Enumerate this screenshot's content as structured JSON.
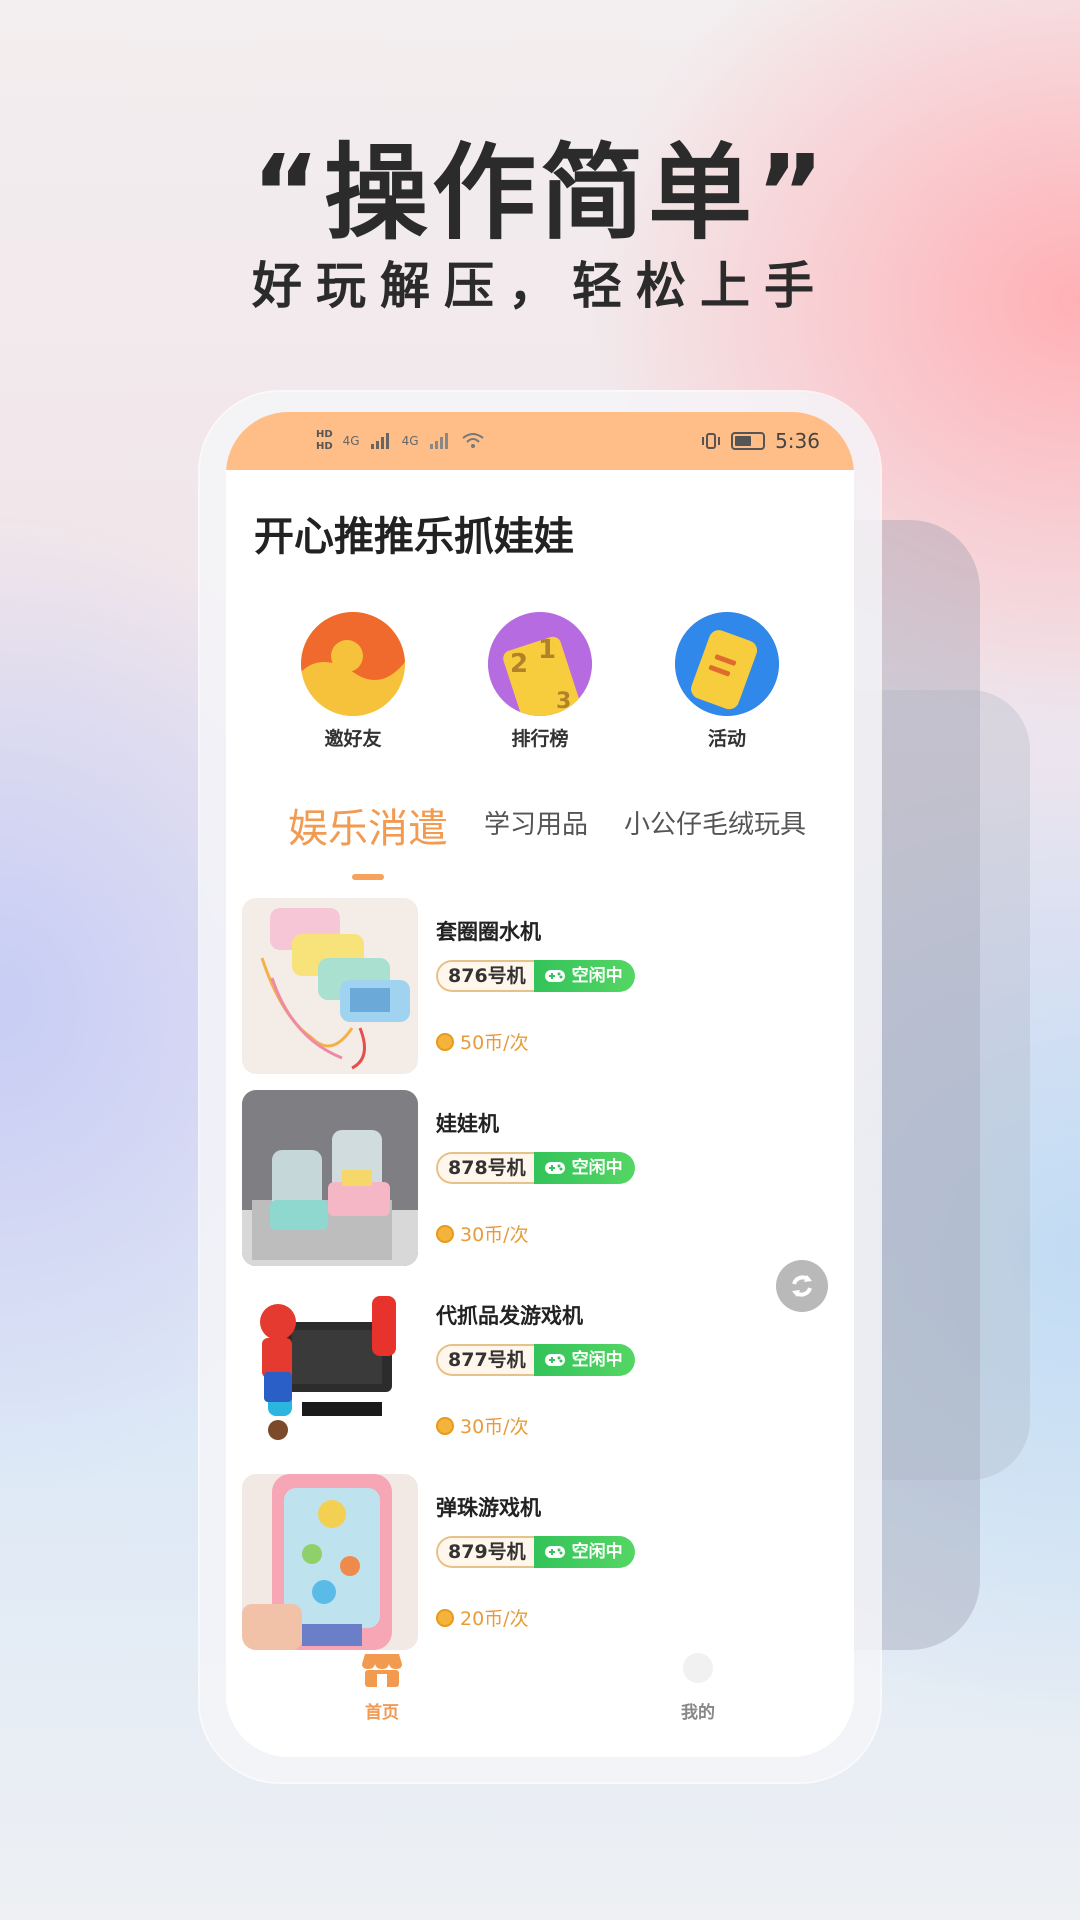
{
  "promo": {
    "headline": "“操作简单”",
    "subline": "好玩解压，轻松上手"
  },
  "status_bar": {
    "left_icons": [
      "HD",
      "4G",
      "signal-icon",
      "4G",
      "signal-icon",
      "wifi-icon"
    ],
    "time": "5:36",
    "right_icons": [
      "vibrate-icon",
      "battery-icon"
    ]
  },
  "app": {
    "title": "开心推推乐抓娃娃"
  },
  "quick_actions": [
    {
      "label": "邀好友",
      "icon": "invite-friends-icon",
      "color": "#f2a33a"
    },
    {
      "label": "排行榜",
      "icon": "leaderboard-icon",
      "color": "#b66ce0"
    },
    {
      "label": "活动",
      "icon": "activity-icon",
      "color": "#2f88ea"
    }
  ],
  "tabs": [
    {
      "label": "娱乐消遣",
      "active": true
    },
    {
      "label": "学习用品",
      "active": false
    },
    {
      "label": "小公仔毛绒玩具",
      "active": false
    }
  ],
  "items": [
    {
      "name": "套圈圈水机",
      "machine": "876号机",
      "status": "空闲中",
      "price": "50币/次",
      "thumb_color": "#f3ece6"
    },
    {
      "name": "娃娃机",
      "machine": "878号机",
      "status": "空闲中",
      "price": "30币/次",
      "thumb_color": "#7d7d80"
    },
    {
      "name": "代抓品发游戏机",
      "machine": "877号机",
      "status": "空闲中",
      "price": "30币/次",
      "thumb_color": "#ffffff"
    },
    {
      "name": "弹珠游戏机",
      "machine": "879号机",
      "status": "空闲中",
      "price": "20币/次",
      "thumb_color": "#f4b9a6"
    }
  ],
  "float_button": {
    "icon": "refresh-icon"
  },
  "bottom_nav": [
    {
      "label": "首页",
      "icon": "shop-icon",
      "active": true,
      "color": "#f39a51"
    },
    {
      "label": "我的",
      "icon": "profile-icon",
      "active": false,
      "color": "#888888"
    }
  ],
  "colors": {
    "accent": "#f39a51",
    "status_green": "#33c35a",
    "status_bar_bg": "#ffbe87"
  }
}
